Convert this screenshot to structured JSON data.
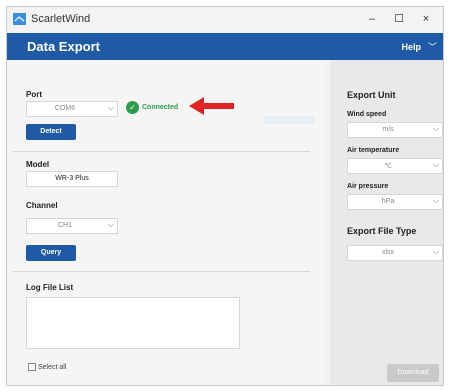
{
  "window": {
    "app_title": "ScarletWind",
    "controls": {
      "minimize": "–",
      "maximize": "☐",
      "close": "×"
    }
  },
  "header": {
    "title": "Data Export",
    "help_label": "Help",
    "help_chev": "﹀"
  },
  "port": {
    "label": "Port",
    "selected": "COM6",
    "status": "Connected",
    "detect_label": "Detect"
  },
  "model": {
    "label": "Model",
    "value": "WR-3 Plus"
  },
  "channel": {
    "label": "Channel",
    "selected": "CH1",
    "query_label": "Query"
  },
  "log": {
    "label": "Log File List",
    "select_all_label": "Select all"
  },
  "export_unit": {
    "title": "Export Unit",
    "wind_speed": {
      "label": "Wind speed",
      "selected": "m/s"
    },
    "air_temperature": {
      "label": "Air temperature",
      "selected": "℃"
    },
    "air_pressure": {
      "label": "Air pressure",
      "selected": "hPa"
    }
  },
  "export_file_type": {
    "title": "Export File Type",
    "selected": "xlsx"
  },
  "download_label": "Download",
  "colors": {
    "accent": "#1f5aa6",
    "success": "#2e9c4a",
    "annotation": "#e02424"
  }
}
